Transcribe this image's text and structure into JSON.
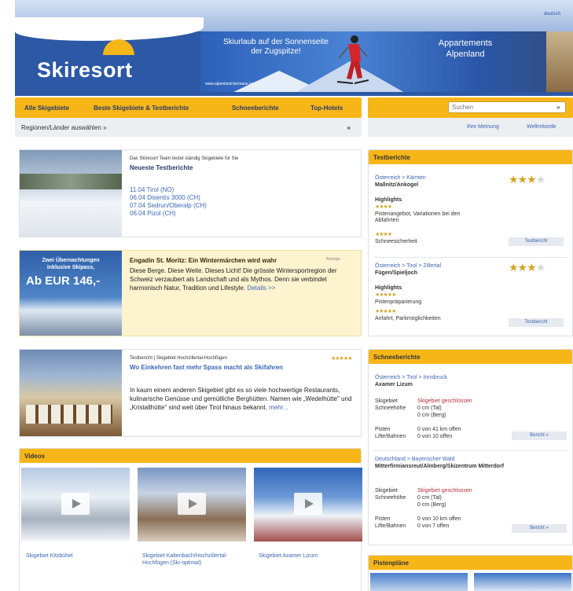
{
  "header": {
    "logo": "Skiresort",
    "language": "deutsch",
    "banner": {
      "left_text_1": "Skiurlaub auf der Sonnenseite",
      "left_text_2": "der Zugspitze!",
      "right_text_1": "Appartements",
      "right_text_2": "Alpenland",
      "url": "www.alpenland-tiermaus.com"
    }
  },
  "nav": {
    "items": [
      "Alle Skigebiete",
      "Beste Skigebiete & Testberichte",
      "Schneeberichte",
      "Top-Hotels"
    ],
    "region_select": "Regionen/Länder auswählen »",
    "region_close": "»"
  },
  "sidebar": {
    "search_placeholder": "Suchen",
    "search_button": "»",
    "links": [
      "Ihre Meinung",
      "Weltrekorde"
    ]
  },
  "testberichte_box": {
    "intro": "Das Skiresort Team testet ständig Skigebiete für Sie",
    "title": "Neueste Testberichte",
    "entries": [
      "11.04 Tirol (NO)",
      "06.04 Disentis 3000 (CH)",
      "07.04 Sedrun/Oberalp (CH)",
      "06.04 Pizol (CH)"
    ]
  },
  "ad_box": {
    "image_line1": "Zwei Übernachtungen",
    "image_line2": "inklusive Skipass,",
    "image_price": "Ab EUR 146,-",
    "title": "Engadin St. Moritz: Ein Wintermärchen wird wahr",
    "tag": "Anzeige",
    "text": "Diese Berge. Diese Weite. Dieses Licht! Die grösste Wintersportregion der Schweiz verzaubert als Landschaft und als Mythos. Denn sie verbindet harmonisch Natur, Tradition und Lifestyle.",
    "link": "Details >>"
  },
  "article_box": {
    "kicker": "Testbericht | Skigebiet Hochzillertal-Hochfügen",
    "stars": "★★★★★",
    "title": "Wo Einkehren fast mehr Spass macht als Skifahren",
    "text": "In kaum einem anderen Skigebiet gibt es so viele hochwertige Restaurants, kulinarische Genüsse und gemütliche Berghütten. Namen wie „Wedelhütte\" und „Kristallhütte\" sind weit über Tirol hinaus bekannt.",
    "link": "mehr..."
  },
  "videos": {
    "title": "Videos",
    "items": [
      {
        "caption": "Skigebiet Kitzbühel"
      },
      {
        "caption": "Skigebiet Kaltenbach/Hochzillertal-Hochfügen (Ski-optimal)"
      },
      {
        "caption": "Skigebiet Axamer Lizum"
      }
    ]
  },
  "right_testberichte": {
    "title": "Testberichte",
    "items": [
      {
        "path": "Österreich > Kärnten",
        "name": "Mallnitz/Ankogel",
        "stars_on": "★★★",
        "stars_off": "★",
        "highlights_label": "Highlights",
        "h1_stars": "★★★★",
        "h1_text": "Pistenangebot, Variationen bei den Abfahrten",
        "h2_stars": "★★★★",
        "h2_text": "Schneesicherheit",
        "button": "Testbericht"
      },
      {
        "path": "Österreich > Tirol > Zillertal",
        "name": "Fügen/Spieljoch",
        "stars_on": "★★★",
        "stars_off": "★",
        "highlights_label": "Highlights",
        "h1_stars": "★★★★★",
        "h1_text": "Pistenpräparierung",
        "h2_stars": "★★★★★",
        "h2_text": "Anfahrt, Parkmöglichkeiten",
        "button": "Testbericht"
      }
    ]
  },
  "schneeberichte": {
    "title": "Schneeberichte",
    "items": [
      {
        "path": "Österreich > Tirol > Innsbruck",
        "name": "Axamer Lizum",
        "rows": [
          {
            "label": "Skigebiet",
            "value": "Skigebiet geschlossen",
            "red": true
          },
          {
            "label": "Schneehöhe",
            "value": "0 cm (Tal)"
          },
          {
            "label": "",
            "value": "0 cm (Berg)"
          },
          {
            "label": "Pisten",
            "value": "0 von 41 km offen"
          },
          {
            "label": "Lifte/Bahnen",
            "value": "0 von 10 offen"
          }
        ],
        "button": "Bericht »"
      },
      {
        "path": "Deutschland > Bayerischer Wald",
        "name": "Mitterfirmiansreut/Almberg/Skizentrum Mitterdorf",
        "rows": [
          {
            "label": "Skigebiet",
            "value": "Skigebiet geschlossen",
            "red": true
          },
          {
            "label": "Schneehöhe",
            "value": "0 cm (Tal)"
          },
          {
            "label": "",
            "value": "0 cm (Berg)"
          },
          {
            "label": "Pisten",
            "value": "0 von 10 km offen"
          },
          {
            "label": "Lifte/Bahnen",
            "value": "0 von 7 offen"
          }
        ],
        "button": "Bericht »"
      }
    ]
  },
  "pistenplaene": {
    "title": "Pistenpläne"
  }
}
